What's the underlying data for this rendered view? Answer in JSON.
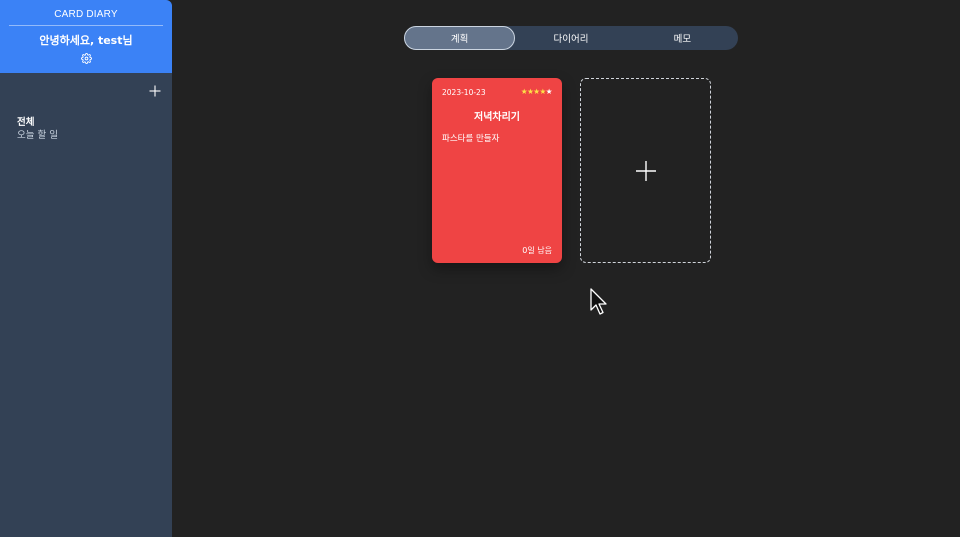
{
  "sidebar": {
    "brand": "CARD DIARY",
    "greeting": "안녕하세요, test님",
    "settings_icon": "gear-icon",
    "add_icon": "plus-icon",
    "categories": [
      {
        "label": "전체",
        "active": true
      },
      {
        "label": "오늘 할 일",
        "active": false
      }
    ]
  },
  "tabs": [
    {
      "label": "계획",
      "active": true
    },
    {
      "label": "다이어리",
      "active": false
    },
    {
      "label": "메모",
      "active": false
    }
  ],
  "cards": [
    {
      "date": "2023-10-23",
      "rating": 4,
      "rating_max": 5,
      "title": "저녁차리기",
      "content": "파스타를 만들자",
      "remaining": "0일 남음",
      "color": "#ef4444"
    }
  ],
  "add_card": {
    "icon": "plus-icon"
  },
  "colors": {
    "sidebar_header": "#3b82f6",
    "sidebar": "#334155",
    "background": "#222222",
    "card": "#ef4444",
    "star": "#fde047"
  }
}
